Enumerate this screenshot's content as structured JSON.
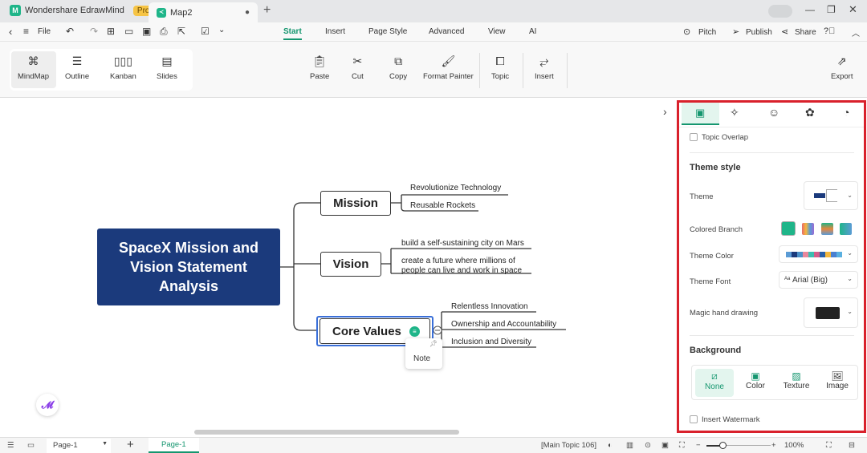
{
  "app": {
    "name": "Wondershare EdrawMind",
    "badge": "Pro",
    "doc_tab": "Map2"
  },
  "menu": {
    "file": "File",
    "tabs": [
      "Start",
      "Insert",
      "Page Style",
      "Advanced",
      "View",
      "AI"
    ],
    "active_tab": "Start",
    "right": {
      "pitch": "Pitch",
      "publish": "Publish",
      "share": "Share"
    }
  },
  "ribbon": {
    "views": [
      "MindMap",
      "Outline",
      "Kanban",
      "Slides"
    ],
    "active_view": "MindMap",
    "tools": [
      "Paste",
      "Cut",
      "Copy",
      "Format Painter",
      "Topic",
      "Insert"
    ],
    "export": "Export"
  },
  "mindmap": {
    "root": "SpaceX Mission and Vision Statement Analysis",
    "branches": [
      {
        "label": "Mission",
        "children": [
          "Revolutionize Technology",
          "Reusable Rockets"
        ]
      },
      {
        "label": "Vision",
        "children": [
          "build a self-sustaining city on Mars",
          "create a future where millions of people can live and work in space"
        ]
      },
      {
        "label": "Core Values",
        "children": [
          "Relentless Innovation",
          "Ownership and Accountability",
          "Inclusion and Diversity"
        ]
      }
    ],
    "note_popup": "Note",
    "colors": {
      "root_bg": "#1b3a7c",
      "selection": "#3a6fd8"
    }
  },
  "panel": {
    "topic_overlap": "Topic Overlap",
    "theme_style": "Theme style",
    "theme": "Theme",
    "colored_branch": "Colored Branch",
    "theme_color": "Theme Color",
    "theme_font": "Theme Font",
    "theme_font_value": "Arial (Big)",
    "theme_font_prefix": "Aa",
    "magic_hand": "Magic hand drawing",
    "background": "Background",
    "bg_options": [
      "None",
      "Color",
      "Texture",
      "Image"
    ],
    "bg_selected": "None",
    "insert_watermark": "Insert Watermark",
    "palette": [
      "#5b9bd5",
      "#1b3a7c",
      "#4a90c8",
      "#e8879c",
      "#3dbdb0",
      "#d45d8a",
      "#2b5fa8",
      "#f5b83d",
      "#4a7fd0",
      "#5ab0e0"
    ],
    "accent": "#15966f",
    "border": "#d9212c"
  },
  "status": {
    "page_select": "Page-1",
    "page_tab": "Page-1",
    "topic_info": "[Main Topic 106]",
    "zoom": "100%"
  }
}
